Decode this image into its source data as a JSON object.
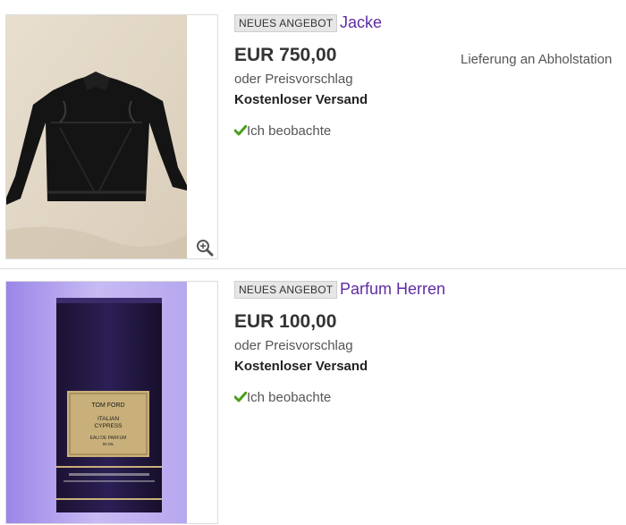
{
  "listings": [
    {
      "badge": "NEUES ANGEBOT",
      "title": "Jacke",
      "price": "EUR 750,00",
      "offer": "oder Preisvorschlag",
      "shipping": "Kostenloser Versand",
      "watch_label": "Ich beobachte",
      "delivery": "Lieferung an Abholstation",
      "image_icon": "zoom-icon"
    },
    {
      "badge": "NEUES ANGEBOT",
      "title": "Parfum Herren",
      "price": "EUR 100,00",
      "offer": "oder Preisvorschlag",
      "shipping": "Kostenloser Versand",
      "watch_label": "Ich beobachte",
      "perfume_box": {
        "brand": "TOM FORD",
        "name_line1": "ITALIAN",
        "name_line2": "CYPRESS",
        "type": "EAU DE PARFUM",
        "volume": "50 ML"
      }
    }
  ],
  "colors": {
    "title_link": "#5e2ca5",
    "check_green": "#4a9d1c",
    "badge_bg": "#e6e6e6"
  }
}
